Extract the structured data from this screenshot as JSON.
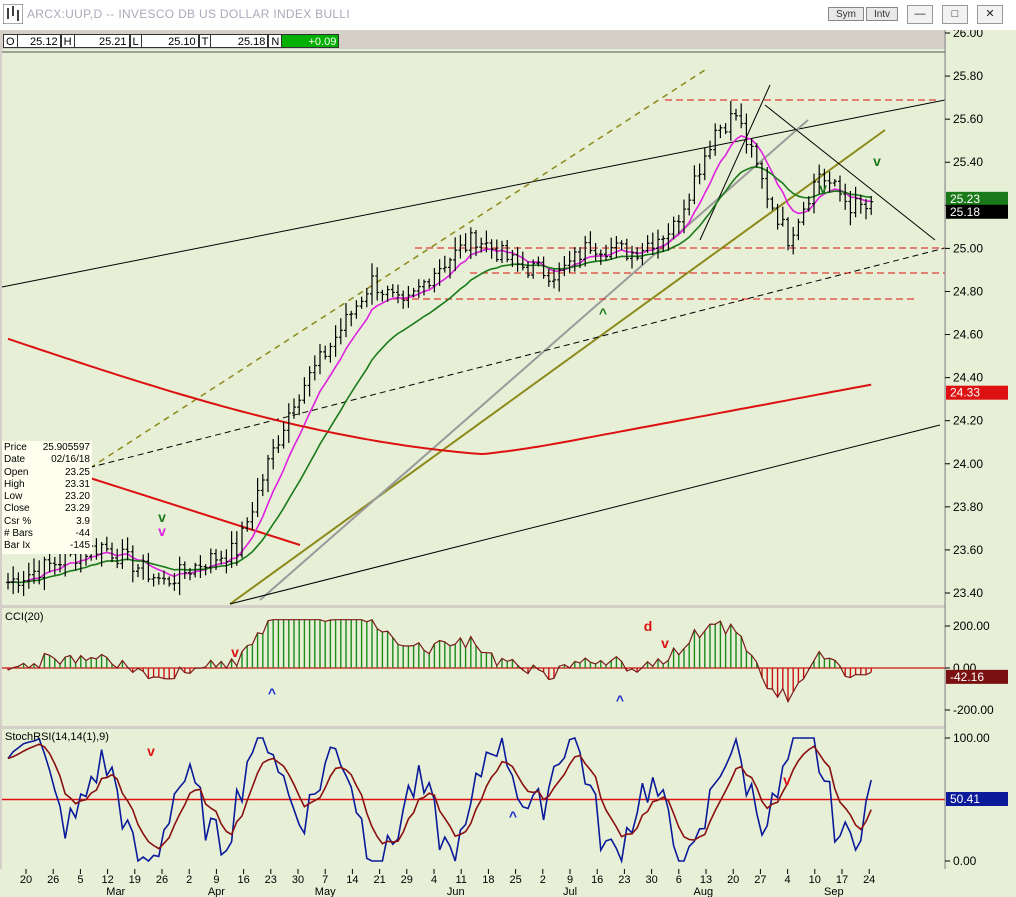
{
  "window": {
    "title": "ARCX:UUP,D -- INVESCO DB US DOLLAR INDEX BULLI",
    "buttons": [
      "Sym",
      "Intv"
    ]
  },
  "quote_bar": {
    "open_label": "O",
    "open": "25.12",
    "high_label": "H",
    "high": "25.21",
    "low_label": "L",
    "low": "25.10",
    "last_label": "T",
    "last": "25.18",
    "net_label": "N",
    "net": "+0.09"
  },
  "info_box": [
    {
      "k": "Price",
      "v": "25.905597"
    },
    {
      "k": "Date",
      "v": "02/16/18"
    },
    {
      "k": "Open",
      "v": "23.25"
    },
    {
      "k": "High",
      "v": "23.31"
    },
    {
      "k": "Low",
      "v": "23.20"
    },
    {
      "k": "Close",
      "v": "23.29"
    },
    {
      "k": "Csr %",
      "v": "3.9"
    },
    {
      "k": "# Bars",
      "v": "-44"
    },
    {
      "k": "Bar Ix",
      "v": "-145"
    }
  ],
  "panels": {
    "cci_label": "CCI(20)",
    "stoch_label": "StochRSI(14,14(1),9)"
  },
  "markers": {
    "v_green": "v",
    "v_magenta": "v",
    "v_red": "v",
    "caret_blue": "^",
    "caret_green": "^",
    "d_red": "d"
  },
  "colors": {
    "background": "#e7f0d7",
    "price_bars": "#000000",
    "ma_fast": "#e020e0",
    "ma_mid": "#1a7a1a",
    "ma_slow": "#dd1111",
    "cci_up": "#1a8a1a",
    "cci_down": "#cc1111",
    "stoch_k": "#0a1a9a",
    "stoch_d": "#8a1010",
    "trend_olive": "#8c8a1a",
    "trend_gray": "#9a9a9a"
  },
  "chart_data": [
    {
      "type": "ohlc",
      "title": "ARCX:UUP,D -- INVESCO DB US DOLLAR INDEX BULLI",
      "x_tick_labels": [
        "20",
        "26",
        "5",
        "12",
        "19",
        "26",
        "2",
        "9",
        "16",
        "23",
        "30",
        "7",
        "14",
        "21",
        "29",
        "4",
        "11",
        "18",
        "25",
        "2",
        "9",
        "16",
        "23",
        "30",
        "6",
        "13",
        "20",
        "27",
        "4",
        "10",
        "17",
        "24"
      ],
      "x_month_labels": [
        "Mar",
        "Apr",
        "May",
        "Jun",
        "Jul",
        "Aug",
        "Sep"
      ],
      "y_ticks": [
        "26.00",
        "25.80",
        "25.60",
        "25.40",
        "25.20",
        "25.00",
        "24.80",
        "24.60",
        "24.40",
        "24.20",
        "24.00",
        "23.80",
        "23.60",
        "23.40"
      ],
      "ylim": [
        23.35,
        26.0
      ],
      "last_close": 25.18,
      "price_labels": {
        "close": "25.18",
        "ma_mid": "25.23",
        "ma_slow": "24.33"
      },
      "series": [
        {
          "name": "Price",
          "values": "daily OHLC bars"
        }
      ]
    },
    {
      "type": "bar",
      "title": "CCI(20)",
      "y_ticks": [
        "200.00",
        "0.00",
        "-200.00"
      ],
      "ylim": [
        -240,
        240
      ],
      "last_value": "-42.16"
    },
    {
      "type": "line",
      "title": "StochRSI(14,14(1),9)",
      "y_ticks": [
        "100.00",
        "0.00"
      ],
      "ylim": [
        -5,
        105
      ],
      "last_value": "50.41"
    }
  ]
}
